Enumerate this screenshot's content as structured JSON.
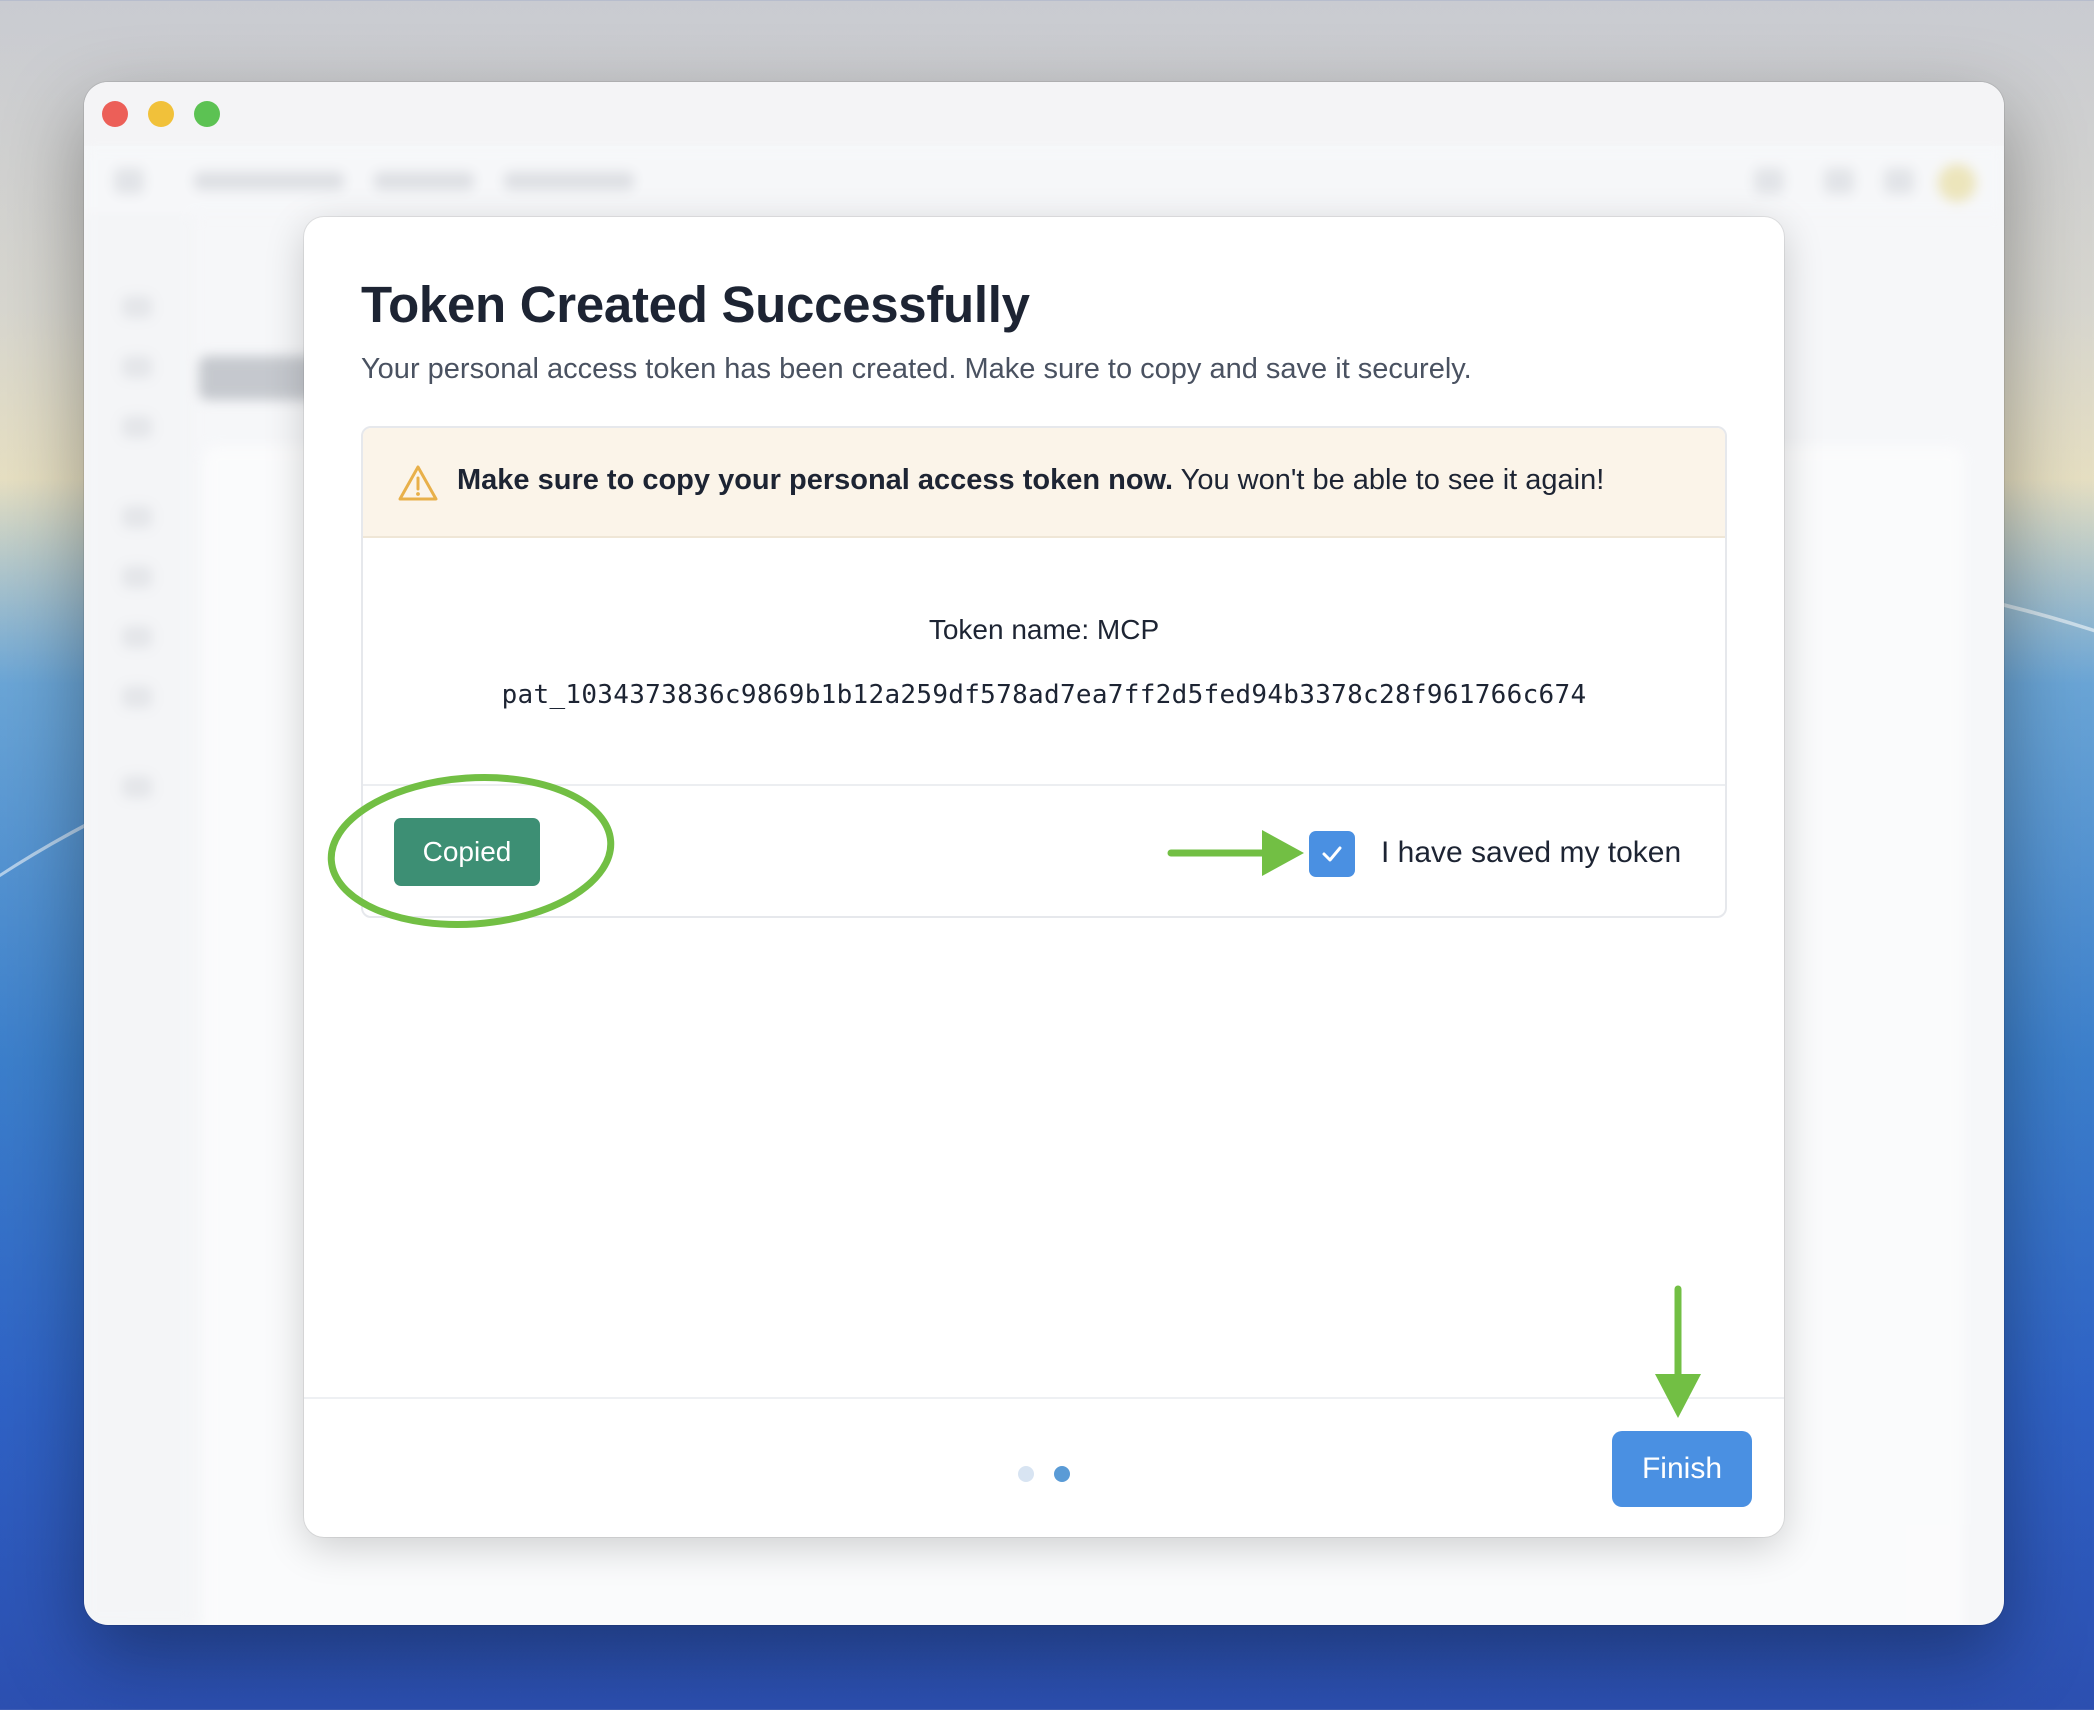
{
  "dialog": {
    "title": "Token Created Successfully",
    "subtitle": "Your personal access token has been created. Make sure to copy and save it securely.",
    "warning": {
      "icon": "warning-triangle-icon",
      "bold_text": "Make sure to copy your personal access token now.",
      "text": " You won't be able to see it again!"
    },
    "token": {
      "name_line": "Token name: MCP",
      "value": "pat_1034373836c9869b1b12a259df578ad7ea7ff2d5fed94b3378c28f961766c674"
    },
    "copy_button_label": "Copied",
    "saved_checkbox": {
      "label": "I have saved my token",
      "checked": true
    },
    "steps": {
      "total": 2,
      "current": 2
    },
    "finish_button_label": "Finish"
  },
  "colors": {
    "primary": "#4a90e2",
    "copied": "#3d8f74",
    "warning_bg": "#fbf4e9",
    "warning_icon": "#e8b04a",
    "annotation_green": "#72bf44"
  }
}
